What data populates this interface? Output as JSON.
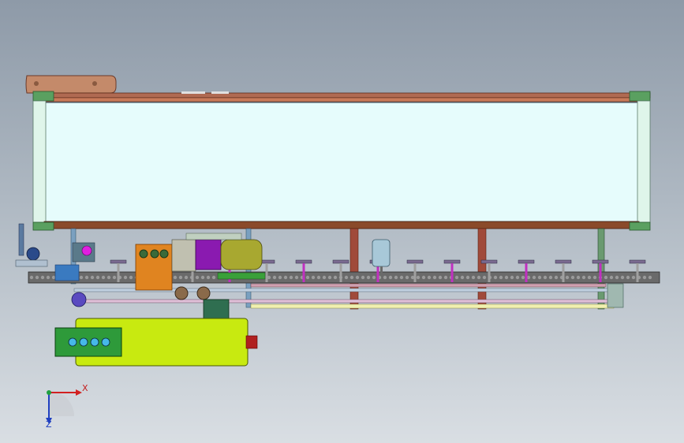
{
  "viewport": {
    "name": "CAD model view",
    "background_top": "#8e9aa8",
    "background_bottom": "#d9dee3"
  },
  "model": {
    "hood_panel_color": "#e6fcfc",
    "frame_top_color": "#b06a52",
    "frame_bottom_color": "#8a4a2a",
    "roller_color": "#dff5ea",
    "chain_color": "#3a3a3a",
    "pusher_color": "#7a6a90",
    "column_color": "#a04a3a",
    "tank_color": "#c8ea10",
    "control_box_color": "#2e9a3a",
    "gearbox_color": "#e08420",
    "motor_purple": "#8a1ab0",
    "motor_olive": "#a8a830",
    "pump_color": "#2f6e50",
    "sensor_color": "#a8c8d8",
    "indicator_lights": [
      "#46b8e8",
      "#46b8e8",
      "#46b8e8",
      "#46b8e8"
    ],
    "pusher_count": 15
  },
  "triad": {
    "x_label": "X",
    "z_label": "Z",
    "x_color": "#d22020",
    "y_color": "#20a040",
    "z_color": "#2040c0"
  }
}
